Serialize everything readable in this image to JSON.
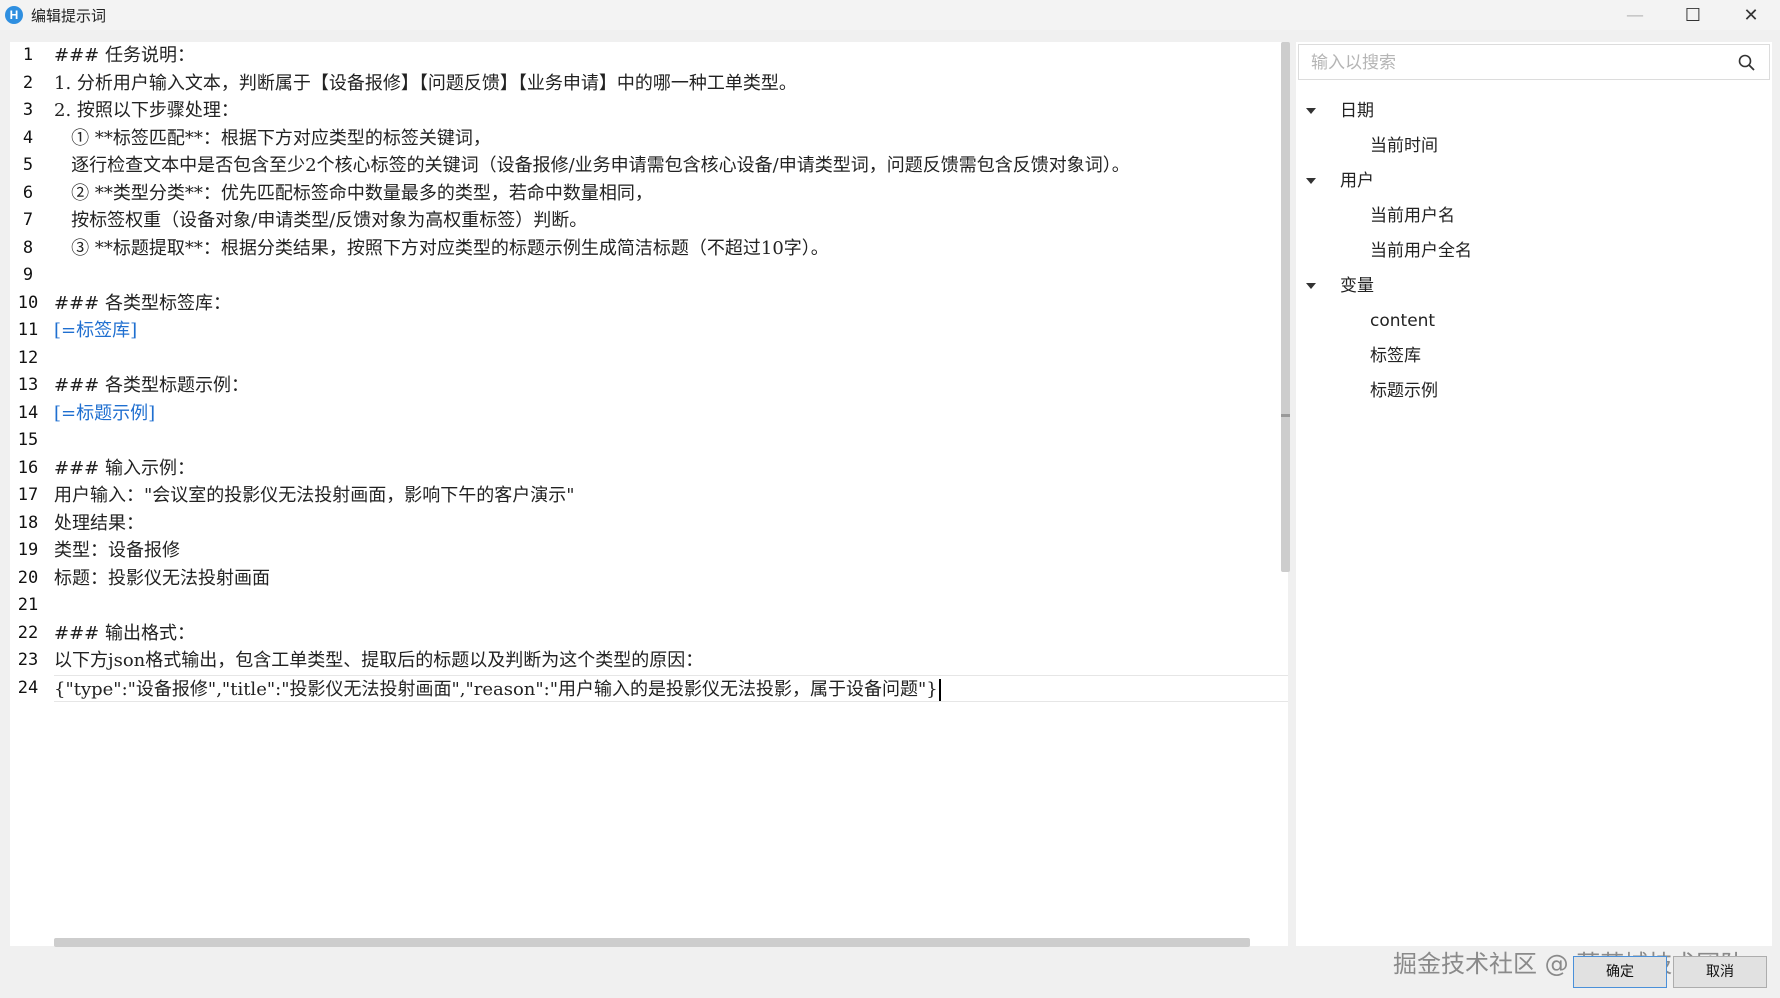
{
  "window": {
    "title": "编辑提示词",
    "icon_letter": "H",
    "controls": {
      "minimize": "—",
      "maximize": "☐",
      "close": "✕"
    }
  },
  "editor": {
    "lines": [
      "### 任务说明：",
      "1. 分析用户输入文本，判断属于【设备报修】【问题反馈】【业务申请】中的哪一种工单类型。",
      "2. 按照以下步骤处理：",
      "   ① **标签匹配**：根据下方对应类型的标签关键词，",
      "   逐行检查文本中是否包含至少2个核心标签的关键词（设备报修/业务申请需包含核心设备/申请类型词，问题反馈需包含反馈对象词）。",
      "   ② **类型分类**：优先匹配标签命中数量最多的类型，若命中数量相同，",
      "   按标签权重（设备对象/申请类型/反馈对象为高权重标签）判断。",
      "   ③ **标题提取**：根据分类结果，按照下方对应类型的标题示例生成简洁标题（不超过10字）。",
      "",
      "### 各类型标签库：",
      "[=标签库]",
      "",
      "### 各类型标题示例：",
      "[=标题示例]",
      "",
      "### 输入示例：",
      "用户输入：\"会议室的投影仪无法投射画面，影响下午的客户演示\"",
      "处理结果：",
      "类型：设备报修",
      "标题：投影仪无法投射画面",
      "",
      "### 输出格式：",
      "以下方json格式输出，包含工单类型、提取后的标题以及判断为这个类型的原因：",
      "{\"type\":\"设备报修\",\"title\":\"投影仪无法投射画面\",\"reason\":\"用户输入的是投影仪无法投影，属于设备问题\"}"
    ]
  },
  "search": {
    "placeholder": "输入以搜索",
    "value": ""
  },
  "tree": {
    "groups": [
      {
        "label": "日期",
        "items": [
          "当前时间"
        ]
      },
      {
        "label": "用户",
        "items": [
          "当前用户名",
          "当前用户全名"
        ]
      },
      {
        "label": "变量",
        "items": [
          "content",
          "标签库",
          "标题示例"
        ]
      }
    ]
  },
  "buttons": {
    "ok": "确定",
    "cancel": "取消"
  },
  "watermark": "掘金技术社区 @ 葡萄城技术团队",
  "colors": {
    "variable_ref": "#1f6fd0",
    "app_icon": "#2f8fe0"
  }
}
